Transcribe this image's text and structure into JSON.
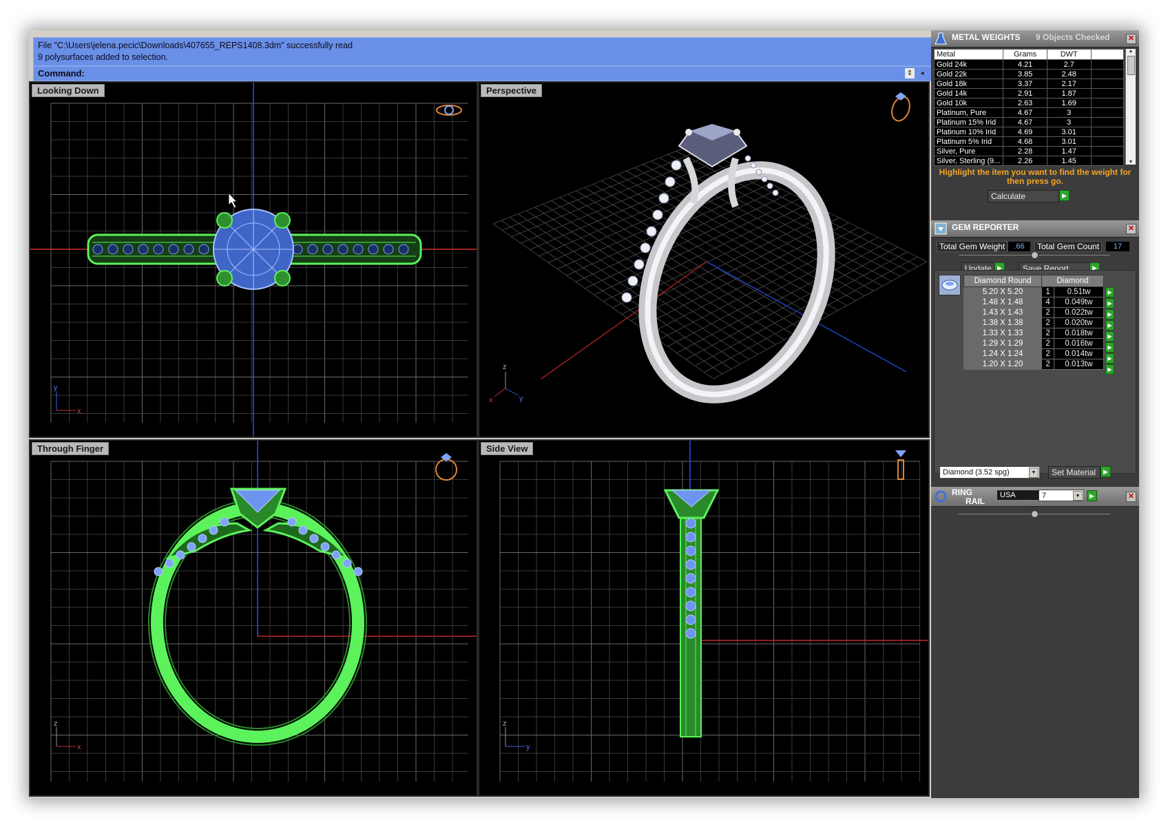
{
  "command": {
    "history": [
      "File \"C:\\Users\\jelena.pecic\\Downloads\\407655_REPS1408.3dm\" successfully read",
      "9 polysurfaces added to selection."
    ],
    "prompt_label": "Command:",
    "value": ""
  },
  "viewports": [
    {
      "title": "Looking Down",
      "axes": [
        "y",
        "x"
      ]
    },
    {
      "title": "Perspective",
      "axes": [
        "z",
        "x",
        "y"
      ]
    },
    {
      "title": "Through Finger",
      "axes": [
        "z",
        "x"
      ]
    },
    {
      "title": "Side View",
      "axes": [
        "z",
        "y"
      ]
    }
  ],
  "metal_weights": {
    "title": "METAL WEIGHTS",
    "status": "9 Objects Checked",
    "columns": [
      "Metal",
      "Grams",
      "DWT"
    ],
    "rows": [
      [
        "Gold 24k",
        "4.21",
        "2.7"
      ],
      [
        "Gold 22k",
        "3.85",
        "2.48"
      ],
      [
        "Gold 18k",
        "3.37",
        "2.17"
      ],
      [
        "Gold 14k",
        "2.91",
        "1.87"
      ],
      [
        "Gold 10k",
        "2.63",
        "1.69"
      ],
      [
        "Platinum, Pure",
        "4.67",
        "3"
      ],
      [
        "Platinum 15% Irid",
        "4.67",
        "3"
      ],
      [
        "Platinum 10% Irid",
        "4.69",
        "3.01"
      ],
      [
        "Platinum 5% Irid",
        "4.68",
        "3.01"
      ],
      [
        "Silver, Pure",
        "2.28",
        "1.47"
      ],
      [
        "Silver, Sterling (9...",
        "2.26",
        "1.45"
      ]
    ],
    "hint": "Highlight the item you want to find the weight for then press go.",
    "calculate_label": "Calculate"
  },
  "gem_reporter": {
    "title": "GEM REPORTER",
    "total_weight_label": "Total Gem Weight",
    "total_weight": ".66",
    "total_count_label": "Total Gem Count",
    "total_count": "17",
    "update_label": "Update",
    "save_label": "Save Report",
    "columns": [
      "Diamond Round",
      "Diamond"
    ],
    "rows": [
      [
        "5.20 X 5.20",
        "1",
        "0.51tw"
      ],
      [
        "1.48 X 1.48",
        "4",
        "0.049tw"
      ],
      [
        "1.43 X 1.43",
        "2",
        "0.022tw"
      ],
      [
        "1.38 X 1.38",
        "2",
        "0.020tw"
      ],
      [
        "1.33 X 1.33",
        "2",
        "0.018tw"
      ],
      [
        "1.29 X 1.29",
        "2",
        "0.016tw"
      ],
      [
        "1.24 X 1.24",
        "2",
        "0.014tw"
      ],
      [
        "1.20 X 1.20",
        "2",
        "0.013tw"
      ]
    ],
    "material_value": "Diamond    (3.52 spg)",
    "set_material_label": "Set Material"
  },
  "ring_rail": {
    "title_line1": "RING",
    "title_line2": "RAIL",
    "standard": "USA",
    "size": "7"
  },
  "colors": {
    "command_bg": "#6a8fe6",
    "panel_bg": "#3c3c3c",
    "wire_green": "#5cf25c",
    "gem_blue": "#7fa4f5",
    "hint_orange": "#f5a623",
    "go_green": "#2ea62e"
  }
}
